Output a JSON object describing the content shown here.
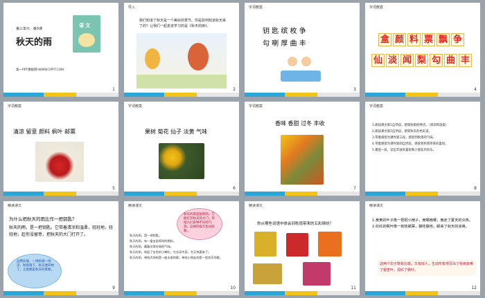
{
  "slides": [
    {
      "num": "1",
      "unit": "第三单元 · 第9课",
      "title": "秋天的雨",
      "book_title": "语 文",
      "footer": "第一PPT模板网-WWW.1PPT.COM"
    },
    {
      "num": "2",
      "header": "导入",
      "text": "我们知道了秋天是一个美好的季节。你是如何知道秋天来了的？让我们一起走进学习的是《秋天的雨》。"
    },
    {
      "num": "3",
      "header": "字词教案",
      "row1": "钥  匙  缤  枚  争",
      "row2": "勾  喇  厚  曲  丰"
    },
    {
      "num": "4",
      "header": "字词教案",
      "row1": [
        "盒",
        "颜",
        "料",
        "票",
        "飘",
        "争"
      ],
      "row2": [
        "仙",
        "淡",
        "闻",
        "梨",
        "勾",
        "曲",
        "丰"
      ]
    },
    {
      "num": "5",
      "header": "字词教案",
      "text": "清凉  留意  颜料  枫叶  邮票"
    },
    {
      "num": "6",
      "header": "字词教案",
      "text": "果树  菊花  仙子  淡黄  气味"
    },
    {
      "num": "7",
      "header": "字词教案",
      "text": "香味  香甜  过冬  丰收"
    },
    {
      "num": "8",
      "header": "字词教案",
      "lines": [
        "1.朗读课文第1自然段，感受秋雨的特点。（清凉和温柔）",
        "2.朗读课文第2自然段，感受秋天的色彩美。",
        "3.带着感受为课时第三段，感受到秋雨的气味。",
        "4.带着感受为课时第四自然段，感受到秋雨带来的喜悦。",
        "5.最后一段，读出丰收的喜悦和小朋友的欢乐。"
      ]
    },
    {
      "num": "9",
      "header": "精读课文",
      "question": "为什么把秋天的雨比作一把钥匙？",
      "body": "秋天的雨，是一把钥匙。它带着清凉和温柔，轻轻地，轻轻地，趁你没留意，把秋天的大门打开了。",
      "bubble": "运用比喻，一场秋雨一场凉，秋雨落下，秋天便开始了，之后便是秋天的景象。"
    },
    {
      "num": "10",
      "header": "精读课文",
      "lines": [
        "秋天的雨，是一把钥匙。",
        "秋天的雨，有一盒五彩缤纷的颜料。",
        "秋天的雨，藏着非常好闻的气味。",
        "秋天的雨，吹起了金色的小喇叭，它告诉大家，冬天快要来了。",
        "秋天的雨，带给大地的是一曲丰收的歌，带给小朋友的是一首欢乐的歌。"
      ],
      "bubble": "秋天的雨是聪明的，它能打开秋天的大门，带给人们各种不同的气息，这样的描写生动形象。"
    },
    {
      "num": "11",
      "header": "精读课文",
      "question": "你从哪些词语中体会到秋雨带来的五彩缤纷？"
    },
    {
      "num": "12",
      "header": "精读课文",
      "lines": [
        "1.黄黄的叶子像一把把小扇子，扇哪扇哪，扇走了夏天的炎热。",
        "2.红红的枫叶像一枚枚邮票，飘哇飘哇，邮来了秋天的凉爽。"
      ],
      "note": "这两个句子既有比喻，又有拟人，生动形象地写出了秋雨染黄了银杏叶，润红了枫叶。"
    }
  ],
  "colors": {
    "blue": "#2aa7d6",
    "yellow": "#f2c418",
    "red": "#e02a1e"
  }
}
